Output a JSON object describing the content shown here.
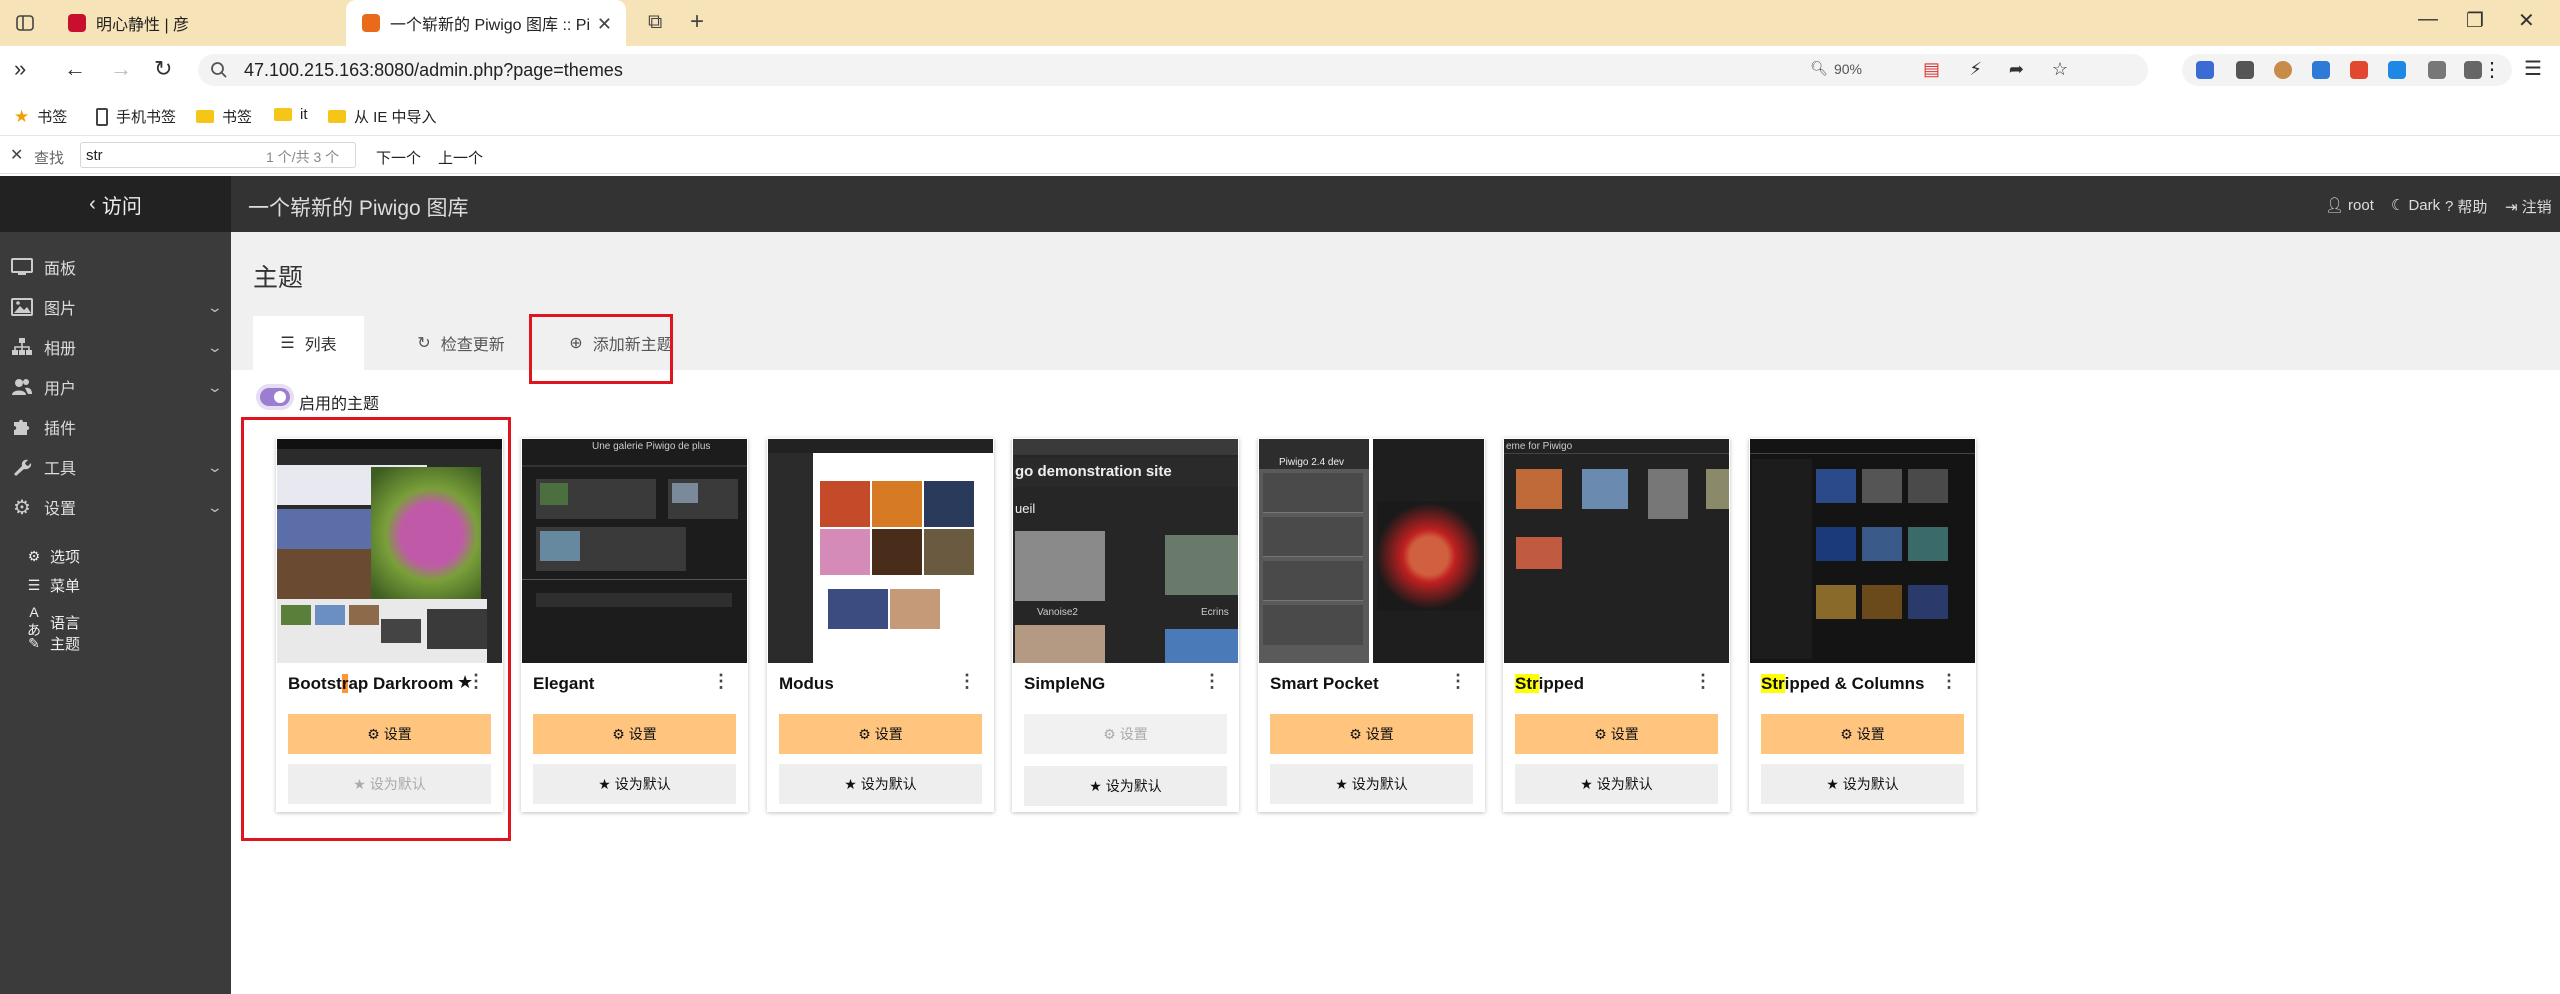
{
  "browser": {
    "tabs": [
      {
        "title": "明心静性 | 彦",
        "active": false
      },
      {
        "title": "一个崭新的 Piwigo 图库 :: Piwigo",
        "active": true
      }
    ],
    "url": "47.100.215.163:8080/admin.php?page=themes",
    "zoom": "90%",
    "bookmarks": [
      "书签",
      "手机书签",
      "书签",
      "it",
      "从 IE 中导入"
    ],
    "find": {
      "label": "查找",
      "query": "str",
      "count": "1 个/共 3 个",
      "next": "下一个",
      "prev": "上一个"
    }
  },
  "app": {
    "visit": "访问",
    "gallery_title": "一个崭新的 Piwigo 图库",
    "header_links": {
      "user": "root",
      "theme": "Dark",
      "help": "帮助",
      "logout": "注销"
    },
    "sidebar": {
      "items": [
        {
          "label": "面板",
          "icon": "monitor-icon",
          "expandable": false
        },
        {
          "label": "图片",
          "icon": "image-icon",
          "expandable": true
        },
        {
          "label": "相册",
          "icon": "sitemap-icon",
          "expandable": true
        },
        {
          "label": "用户",
          "icon": "users-icon",
          "expandable": true
        },
        {
          "label": "插件",
          "icon": "puzzle-icon",
          "expandable": false
        },
        {
          "label": "工具",
          "icon": "wrench-icon",
          "expandable": true
        },
        {
          "label": "设置",
          "icon": "gear-icon",
          "expandable": true
        }
      ],
      "subitems": [
        {
          "label": "选项",
          "icon": "cogs-icon"
        },
        {
          "label": "菜单",
          "icon": "menu-icon"
        },
        {
          "label": "语言",
          "icon": "language-icon"
        },
        {
          "label": "主题",
          "icon": "brush-icon"
        }
      ]
    },
    "page_title": "主题",
    "tabs": {
      "list": "列表",
      "check_updates": "检查更新",
      "add_theme": "添加新主题"
    },
    "section_label": "启用的主题",
    "themes": [
      {
        "name_pre": "Bootst",
        "name_hl": "r",
        "name_post": "ap Darkroom",
        "hl_type": "current",
        "is_default": true,
        "settings": "设置",
        "set_default": "设为默认",
        "settings_enabled": true
      },
      {
        "name_pre": "Elegant",
        "name_hl": "",
        "name_post": "",
        "hl_type": "none",
        "is_default": false,
        "settings": "设置",
        "set_default": "设为默认",
        "settings_enabled": true
      },
      {
        "name_pre": "Modus",
        "name_hl": "",
        "name_post": "",
        "hl_type": "none",
        "is_default": false,
        "settings": "设置",
        "set_default": "设为默认",
        "settings_enabled": true
      },
      {
        "name_pre": "SimpleNG",
        "name_hl": "",
        "name_post": "",
        "hl_type": "none",
        "is_default": false,
        "settings": "设置",
        "set_default": "设为默认",
        "settings_enabled": false
      },
      {
        "name_pre": "Smart Pocket",
        "name_hl": "",
        "name_post": "",
        "hl_type": "none",
        "is_default": false,
        "settings": "设置",
        "set_default": "设为默认",
        "settings_enabled": true
      },
      {
        "name_pre": "",
        "name_hl": "Str",
        "name_post": "ipped",
        "hl_type": "match",
        "is_default": false,
        "settings": "设置",
        "set_default": "设为默认",
        "settings_enabled": true
      },
      {
        "name_pre": "",
        "name_hl": "Str",
        "name_post": "ipped & Columns",
        "hl_type": "match",
        "is_default": false,
        "settings": "设置",
        "set_default": "设为默认",
        "settings_enabled": true
      }
    ],
    "thumb_texts": {
      "elegant_title": "Une galerie Piwigo de plus",
      "simpleng_banner": "go demonstration site",
      "simpleng_sub": "ueil",
      "simpleng_cap1": "Vanoise2",
      "simpleng_cap2": "Ecrins",
      "smartpocket_title": "Piwigo 2.4 dev",
      "stripped_title": "eme for Piwigo"
    }
  },
  "colors": {
    "tab_bar": "#f7e3b8",
    "sidebar": "#3b3b3b",
    "header": "#333333",
    "settings_button": "#ffc57f",
    "annotation_red": "#e0141e",
    "toggle_purple": "#9b7ed0"
  }
}
